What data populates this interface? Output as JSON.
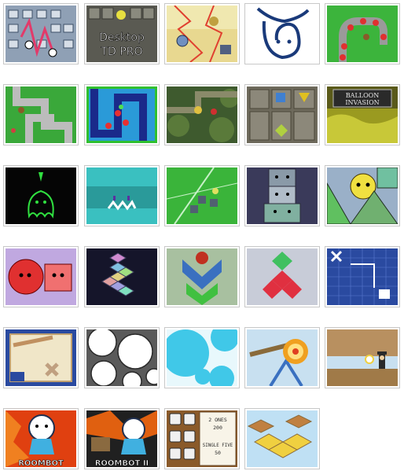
{
  "gallery": {
    "tiles": [
      {
        "name": "game-thumb-td-classic",
        "title": ""
      },
      {
        "name": "game-thumb-desktop-td-pro",
        "title_line1": "Desktop",
        "title_line2": "TD PRO"
      },
      {
        "name": "game-thumb-lightning",
        "title": ""
      },
      {
        "name": "game-thumb-mascot-logo",
        "title": ""
      },
      {
        "name": "game-thumb-balloon-path",
        "title": ""
      },
      {
        "name": "game-thumb-maze-grass",
        "title": ""
      },
      {
        "name": "game-thumb-blue-path",
        "title": ""
      },
      {
        "name": "game-thumb-forest-td",
        "title": ""
      },
      {
        "name": "game-thumb-stone-td",
        "title": ""
      },
      {
        "name": "game-thumb-balloon-invasion",
        "title_line1": "BALLOON",
        "title_line2": "INVASION"
      },
      {
        "name": "game-thumb-green-glow",
        "title": ""
      },
      {
        "name": "game-thumb-cyan-creature",
        "title": ""
      },
      {
        "name": "game-thumb-green-battle",
        "title": ""
      },
      {
        "name": "game-thumb-totem",
        "title": ""
      },
      {
        "name": "game-thumb-triangle-faces",
        "title": ""
      },
      {
        "name": "game-thumb-red-pink-blocks",
        "title": ""
      },
      {
        "name": "game-thumb-pastel-tetris",
        "title": ""
      },
      {
        "name": "game-thumb-green-chevrons",
        "title": ""
      },
      {
        "name": "game-thumb-red-green-blocks",
        "title": ""
      },
      {
        "name": "game-thumb-blueprint",
        "title": ""
      },
      {
        "name": "game-thumb-blueprint-cannon",
        "title": ""
      },
      {
        "name": "game-thumb-white-circles",
        "title": ""
      },
      {
        "name": "game-thumb-blue-bubbles",
        "title": ""
      },
      {
        "name": "game-thumb-target",
        "title": ""
      },
      {
        "name": "game-thumb-desert-figure",
        "title": ""
      },
      {
        "name": "game-thumb-roombot",
        "title": "ROOMBOT"
      },
      {
        "name": "game-thumb-roombot-2",
        "title": "ROOMBOT II"
      },
      {
        "name": "game-thumb-dice",
        "score_line1": "2 ONES",
        "score_line2": "200",
        "score_line3": "SINGLE FIVE",
        "score_line4": "50"
      },
      {
        "name": "game-thumb-isometric-boxes",
        "title": ""
      }
    ]
  }
}
